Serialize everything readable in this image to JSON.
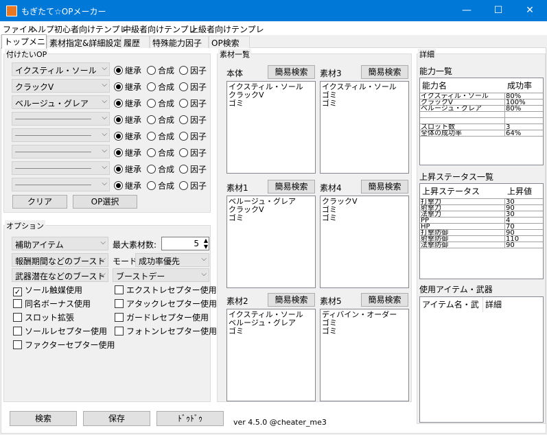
{
  "window": {
    "title": "もぎたて☆OPメーカー",
    "min": "—",
    "max": "☐",
    "close": "✕",
    "icon": "app-icon"
  },
  "menu": [
    "ファイル",
    "ヘルプ",
    "初心者向けテンプレ",
    "中級者向けテンプレ",
    "上級者向けテンプレ"
  ],
  "tabs": [
    "トップメニュー",
    "素材指定&詳細設定",
    "履歴",
    "特殊能力因子",
    "OP検索"
  ],
  "op_group": {
    "label": "付けたいOP",
    "rows": [
      {
        "value": "イクスティル・ソール",
        "blank": false
      },
      {
        "value": "クラックV",
        "blank": false
      },
      {
        "value": "ベルージュ・グレア",
        "blank": false
      },
      {
        "value": "",
        "blank": true
      },
      {
        "value": "",
        "blank": true
      },
      {
        "value": "",
        "blank": true
      },
      {
        "value": "",
        "blank": true
      },
      {
        "value": "",
        "blank": true
      }
    ],
    "radios": [
      "継承",
      "合成",
      "因子"
    ],
    "clear": "クリア",
    "select": "OP選択"
  },
  "options": {
    "label": "オプション",
    "aux": "補助アイテム",
    "max_label": "最大素材数:",
    "max_value": "5",
    "boost1": "報酬期間などのブースト",
    "mode_label": "モード:",
    "mode_value": "成功率優先",
    "boost2": "武器潜在などのブースト",
    "boost_day": "ブーストデー",
    "left_checks": [
      {
        "label": "ソール触媒使用",
        "checked": true
      },
      {
        "label": "同名ボーナス使用",
        "checked": false
      },
      {
        "label": "スロット拡張",
        "checked": false
      },
      {
        "label": "ソールレセプター使用",
        "checked": false
      },
      {
        "label": "ファクターセプター使用",
        "checked": false
      }
    ],
    "right_checks": [
      {
        "label": "エクストレセプター使用",
        "checked": false
      },
      {
        "label": "アタックレセプター使用",
        "checked": false
      },
      {
        "label": "ガードレセプター使用",
        "checked": false
      },
      {
        "label": "フォトンレセプター使用",
        "checked": false
      }
    ]
  },
  "materials": {
    "label": "素材一覧",
    "search": "簡易検索",
    "boxes": [
      {
        "name": "本体",
        "items": [
          "イクスティル・ソール",
          "クラックV",
          "ゴミ"
        ]
      },
      {
        "name": "素材3",
        "items": [
          "イクスティル・ソール",
          "ゴミ",
          "ゴミ"
        ]
      },
      {
        "name": "素材1",
        "items": [
          "ベルージュ・グレア",
          "クラックV",
          "ゴミ"
        ]
      },
      {
        "name": "素材4",
        "items": [
          "クラックV",
          "ゴミ",
          "ゴミ"
        ]
      },
      {
        "name": "素材2",
        "items": [
          "イクスティル・ソール",
          "ベルージュ・グレア",
          "ゴミ"
        ]
      },
      {
        "name": "素材5",
        "items": [
          "ディバイン・オーダー",
          "ゴミ",
          "ゴミ"
        ]
      }
    ]
  },
  "details": {
    "label": "詳細",
    "ability_title": "能力一覧",
    "ability_headers": [
      "能力名",
      "成功率"
    ],
    "ability_rows": [
      [
        "イクスティル・ソール",
        "80%"
      ],
      [
        "クラックV",
        "100%"
      ],
      [
        "ベルージュ・グレア",
        "80%"
      ],
      [
        "",
        ""
      ],
      [
        "",
        ""
      ],
      [
        "スロット数",
        "3"
      ],
      [
        "全体の成功率",
        "64%"
      ]
    ],
    "status_title": "上昇ステータス一覧",
    "status_headers": [
      "上昇ステータス",
      "上昇値"
    ],
    "status_rows": [
      [
        "打撃力",
        "30"
      ],
      [
        "射撃力",
        "90"
      ],
      [
        "法撃力",
        "30"
      ],
      [
        "PP",
        "4"
      ],
      [
        "HP",
        "70"
      ],
      [
        "打撃防御",
        "90"
      ],
      [
        "射撃防御",
        "110"
      ],
      [
        "法撃防御",
        "90"
      ]
    ],
    "items_title": "使用アイテム・武器",
    "items_headers": [
      "アイテム名・武器...",
      "詳細"
    ]
  },
  "footer": {
    "search": "検索",
    "save": "保存",
    "dodo": "ﾄﾞｩﾄﾞｩ",
    "version": "ver 4.5.0 @cheater_me3"
  }
}
